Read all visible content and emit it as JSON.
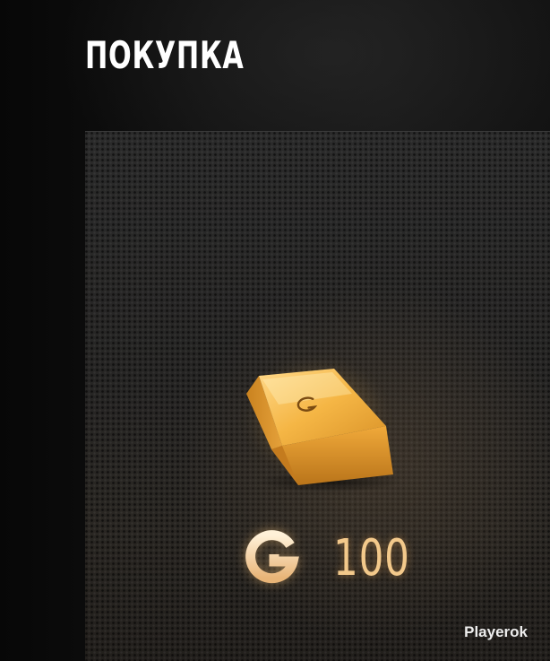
{
  "header": {
    "title": "ПОКУПКА"
  },
  "item": {
    "icon": "gold-bar-icon",
    "currency_icon": "gold-currency-icon",
    "amount": "100"
  },
  "watermark": {
    "text": "Playerok"
  },
  "colors": {
    "background": "#0b0b0b",
    "card": "#2a2826",
    "title": "#ffffff",
    "gold": "#f3c98b",
    "gold_bar": "#e7a433"
  }
}
